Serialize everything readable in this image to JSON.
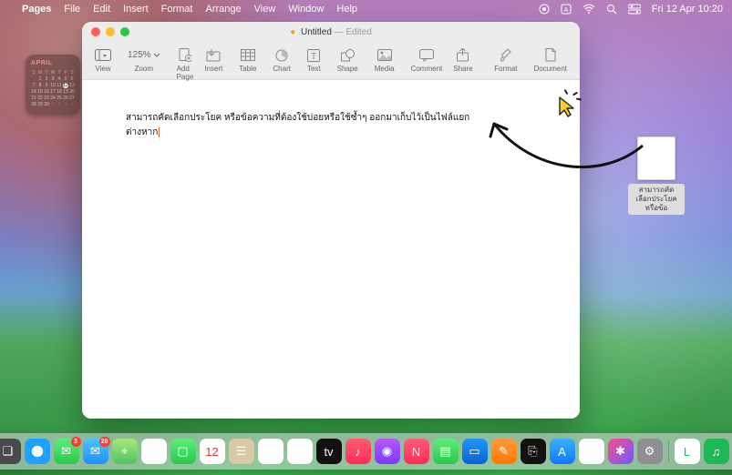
{
  "menubar": {
    "app": "Pages",
    "items": [
      "File",
      "Edit",
      "Insert",
      "Format",
      "Arrange",
      "View",
      "Window",
      "Help"
    ],
    "clock": "Fri 12 Apr  10:20"
  },
  "window": {
    "title": "Untitled",
    "state": "Edited",
    "toolbar": {
      "view": "View",
      "zoom": "Zoom",
      "zoom_value": "125%",
      "addpage": "Add Page",
      "insert": "Insert",
      "table": "Table",
      "chart": "Chart",
      "text": "Text",
      "shape": "Shape",
      "media": "Media",
      "comment": "Comment",
      "share": "Share",
      "format": "Format",
      "document": "Document"
    },
    "document": {
      "line1": "สามารถคัดเลือกประโยค หรือข้อความที่ต้องใช้บ่อยหรือใช้ซ้ำๆ ออกมาเก็บไว้เป็นไฟล์แยก",
      "line2": "ต่างหาก"
    }
  },
  "calendar": {
    "month": "APRIL",
    "headers": [
      "S",
      "M",
      "T",
      "W",
      "T",
      "F",
      "S"
    ],
    "rows": [
      [
        "",
        "1",
        "2",
        "3",
        "4",
        "5",
        "6"
      ],
      [
        "7",
        "8",
        "9",
        "10",
        "11",
        "12",
        "13"
      ],
      [
        "14",
        "15",
        "16",
        "17",
        "18",
        "19",
        "20"
      ],
      [
        "21",
        "22",
        "23",
        "24",
        "25",
        "26",
        "27"
      ],
      [
        "28",
        "29",
        "30",
        "1",
        "2",
        "3",
        "4"
      ]
    ],
    "today": "12"
  },
  "desktop_file": {
    "name": "สามารถคัดเลือกประโยค หรือข้อ"
  },
  "dock": {
    "items": [
      {
        "name": "finder",
        "bg": "linear-gradient(135deg,#1ea4ff,#0a6ae0)",
        "glyph": "☺"
      },
      {
        "name": "launchpad",
        "bg": "#8e8e93",
        "glyph": "▦"
      },
      {
        "name": "mission-control",
        "bg": "#4a4a4c",
        "glyph": "❏"
      },
      {
        "name": "safari",
        "bg": "radial-gradient(circle,#fff 30%,#1fa2ff 32%)",
        "glyph": "✦"
      },
      {
        "name": "messages",
        "bg": "linear-gradient(#5ded79,#29c94b)",
        "glyph": "✉",
        "badge": "3"
      },
      {
        "name": "mail",
        "bg": "linear-gradient(#4cc4ff,#1f8fff)",
        "glyph": "✉",
        "badge": "28"
      },
      {
        "name": "maps",
        "bg": "linear-gradient(#a9e977,#4fc264)",
        "glyph": "⌖"
      },
      {
        "name": "photos",
        "bg": "#fff",
        "glyph": "✿"
      },
      {
        "name": "facetime",
        "bg": "linear-gradient(#5ded79,#29c94b)",
        "glyph": "▢"
      },
      {
        "name": "calendar",
        "bg": "#fff",
        "glyph": "12",
        "text": "#e33"
      },
      {
        "name": "contacts",
        "bg": "#d9c9a6",
        "glyph": "☰"
      },
      {
        "name": "reminders",
        "bg": "#fff",
        "glyph": "≣"
      },
      {
        "name": "notes",
        "bg": "#fff",
        "glyph": "≡"
      },
      {
        "name": "tv",
        "bg": "#111",
        "glyph": "tv"
      },
      {
        "name": "music",
        "bg": "linear-gradient(#ff5c74,#ff2d55)",
        "glyph": "♪"
      },
      {
        "name": "podcasts",
        "bg": "linear-gradient(#b756ff,#7a3cff)",
        "glyph": "◉"
      },
      {
        "name": "news",
        "bg": "linear-gradient(#ff5c74,#ff2d55)",
        "glyph": "N"
      },
      {
        "name": "numbers",
        "bg": "linear-gradient(#5ded79,#29c94b)",
        "glyph": "▤"
      },
      {
        "name": "keynote",
        "bg": "linear-gradient(#2196f3,#0b62d6)",
        "glyph": "▭"
      },
      {
        "name": "pages",
        "bg": "linear-gradient(#ff9a3c,#ff7a00)",
        "glyph": "✎"
      },
      {
        "name": "voice",
        "bg": "#111",
        "glyph": "⎘"
      },
      {
        "name": "appstore",
        "bg": "linear-gradient(#36b3ff,#1478ff)",
        "glyph": "A"
      },
      {
        "name": "find-my",
        "bg": "#fff",
        "glyph": "◎"
      },
      {
        "name": "shortcuts",
        "bg": "linear-gradient(135deg,#ff4a8d,#6a5cff)",
        "glyph": "✱"
      },
      {
        "name": "settings",
        "bg": "#8e8e93",
        "glyph": "⚙"
      },
      {
        "name": "sep"
      },
      {
        "name": "line",
        "bg": "#fff",
        "glyph": "L",
        "text": "#06c755"
      },
      {
        "name": "spotify",
        "bg": "#1db954",
        "glyph": "♫"
      },
      {
        "name": "sep"
      },
      {
        "name": "downloads",
        "bg": "#6aa0c9",
        "glyph": "⬇"
      },
      {
        "name": "trash",
        "bg": "rgba(255,255,255,.4)",
        "glyph": "🗑"
      }
    ]
  }
}
